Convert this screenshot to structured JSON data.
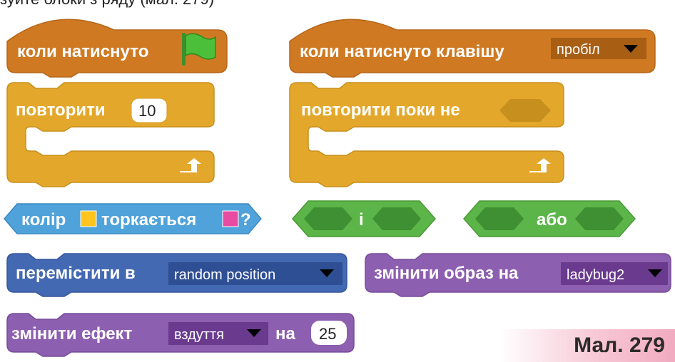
{
  "top_cut_text": "зуйте блоки з ряду (мал. 279)",
  "colors": {
    "events": "#cf7a23",
    "control": "#e3a82b",
    "sensing": "#4fa2da",
    "operators": "#5cb548",
    "motion": "#4469b3",
    "looks": "#8d5fb0"
  },
  "blocks": {
    "when_flag": {
      "label": "коли натиснуто",
      "icon": "green-flag-icon"
    },
    "when_key": {
      "label": "коли натиснуто клавішу",
      "key": "пробіл"
    },
    "repeat": {
      "label": "повторити",
      "count": "10"
    },
    "repeat_until": {
      "label": "повторити поки не"
    },
    "color_touching": {
      "label_1": "колір",
      "label_2": "торкається",
      "q": "?",
      "color_a": "#ffc41e",
      "color_b": "#e94ba1"
    },
    "and_op": {
      "label": "і"
    },
    "or_op": {
      "label": "або"
    },
    "go_to": {
      "label": "перемістити в",
      "target": "random position"
    },
    "switch_costume": {
      "label": "змінити образ на",
      "costume": "ladybug2"
    },
    "change_effect": {
      "label_1": "змінити ефект",
      "effect": "вздуття",
      "label_2": "на",
      "value": "25"
    }
  },
  "caption": "Мал. 279"
}
